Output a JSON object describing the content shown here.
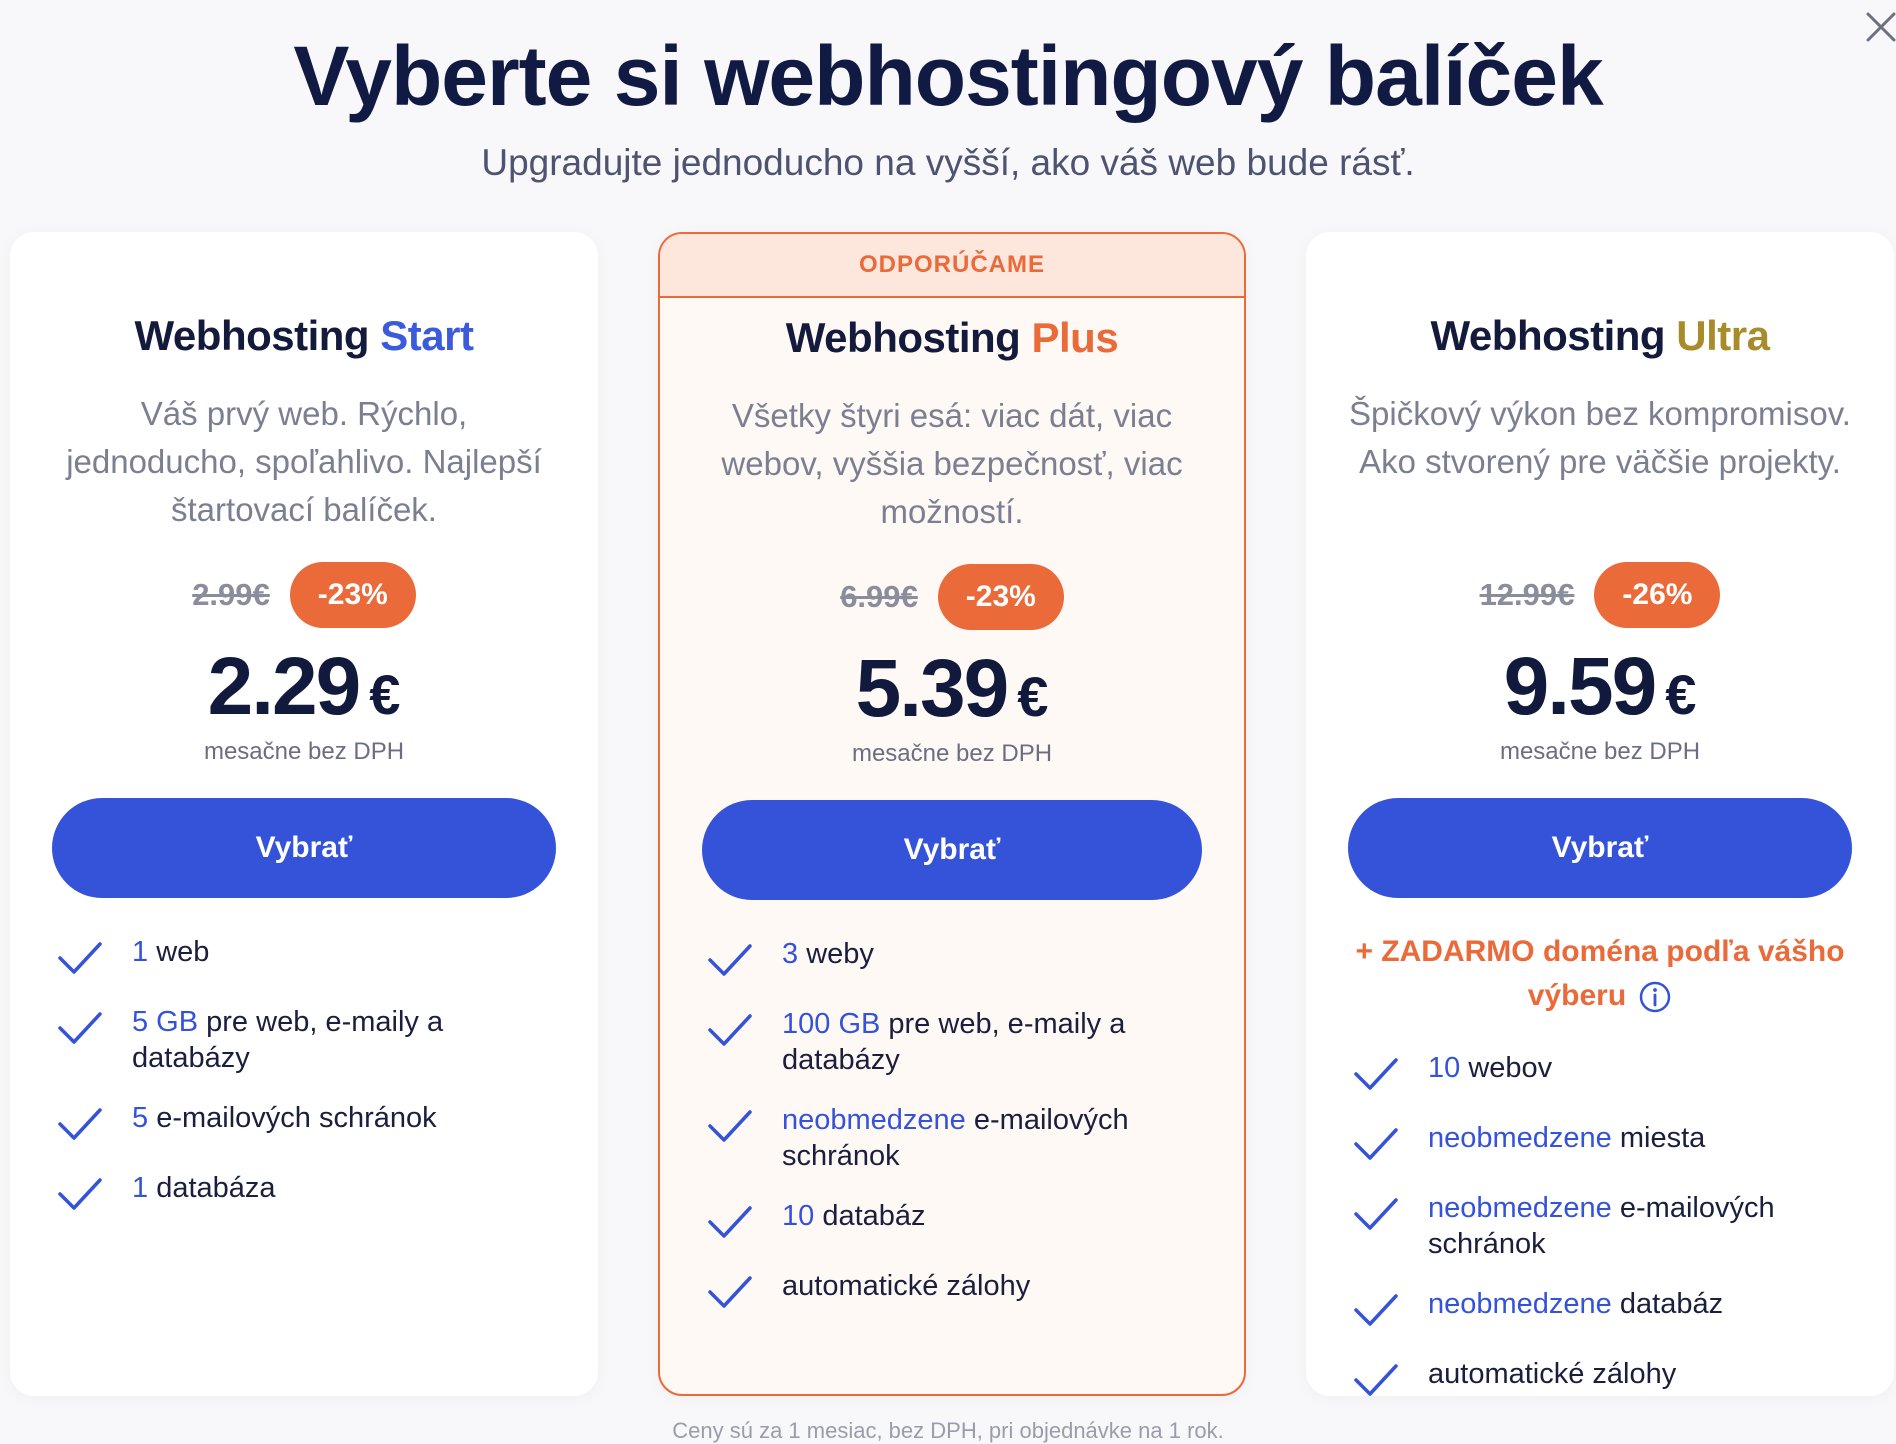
{
  "header": {
    "title": "Vyberte si webhostingový balíček",
    "subtitle": "Upgradujte jednoducho na vyšší, ako váš web bude rásť."
  },
  "close_icon": "close-icon",
  "plans": [
    {
      "name_prefix": "Webhosting",
      "name_accent": "Start",
      "description": "Váš prvý web. Rýchlo, jednoducho, spoľahlivo. Najlepší štartovací balíček.",
      "old_price": "2.99€",
      "discount": "-23%",
      "price": "2.29",
      "currency": "€",
      "price_note": "mesačne bez DPH",
      "button": "Vybrať",
      "features": [
        {
          "highlight": "1",
          "text": " web"
        },
        {
          "highlight": "5 GB",
          "text": " pre web, e-maily a databázy"
        },
        {
          "highlight": "5",
          "text": " e-mailových schránok"
        },
        {
          "highlight": "1",
          "text": " databáza"
        }
      ]
    },
    {
      "ribbon": "ODPORÚČAME",
      "name_prefix": "Webhosting",
      "name_accent": "Plus",
      "description": "Všetky štyri esá: viac dát, viac webov, vyššia bezpečnosť, viac možností.",
      "old_price": "6.99€",
      "discount": "-23%",
      "price": "5.39",
      "currency": "€",
      "price_note": "mesačne bez DPH",
      "button": "Vybrať",
      "features": [
        {
          "highlight": "3",
          "text": " weby"
        },
        {
          "highlight": "100 GB",
          "text": " pre web, e-maily a databázy"
        },
        {
          "highlight": "neobmedzene",
          "text": " e-mailových schránok"
        },
        {
          "highlight": "10",
          "text": " databáz"
        },
        {
          "highlight": "",
          "text": "automatické zálohy"
        }
      ]
    },
    {
      "name_prefix": "Webhosting",
      "name_accent": "Ultra",
      "description": "Špičkový výkon bez kompromisov. Ako stvorený pre väčšie projekty.",
      "old_price": "12.99€",
      "discount": "-26%",
      "price": "9.59",
      "currency": "€",
      "price_note": "mesačne bez DPH",
      "button": "Vybrať",
      "promo": "+ ZADARMO doména podľa vášho výberu",
      "features": [
        {
          "highlight": "10",
          "text": " webov"
        },
        {
          "highlight": "neobmedzene",
          "text": " miesta"
        },
        {
          "highlight": "neobmedzene",
          "text": " e-mailových schránok"
        },
        {
          "highlight": "neobmedzene",
          "text": " databáz"
        },
        {
          "highlight": "",
          "text": "automatické zálohy"
        }
      ]
    }
  ],
  "footer_note": "Ceny sú za 1 mesiac, bez DPH, pri objednávke na 1 rok.",
  "colors": {
    "primary": "#3553d8",
    "accent_orange": "#ea6a3a",
    "accent_gold": "#a88c2a",
    "title": "#111a43"
  }
}
